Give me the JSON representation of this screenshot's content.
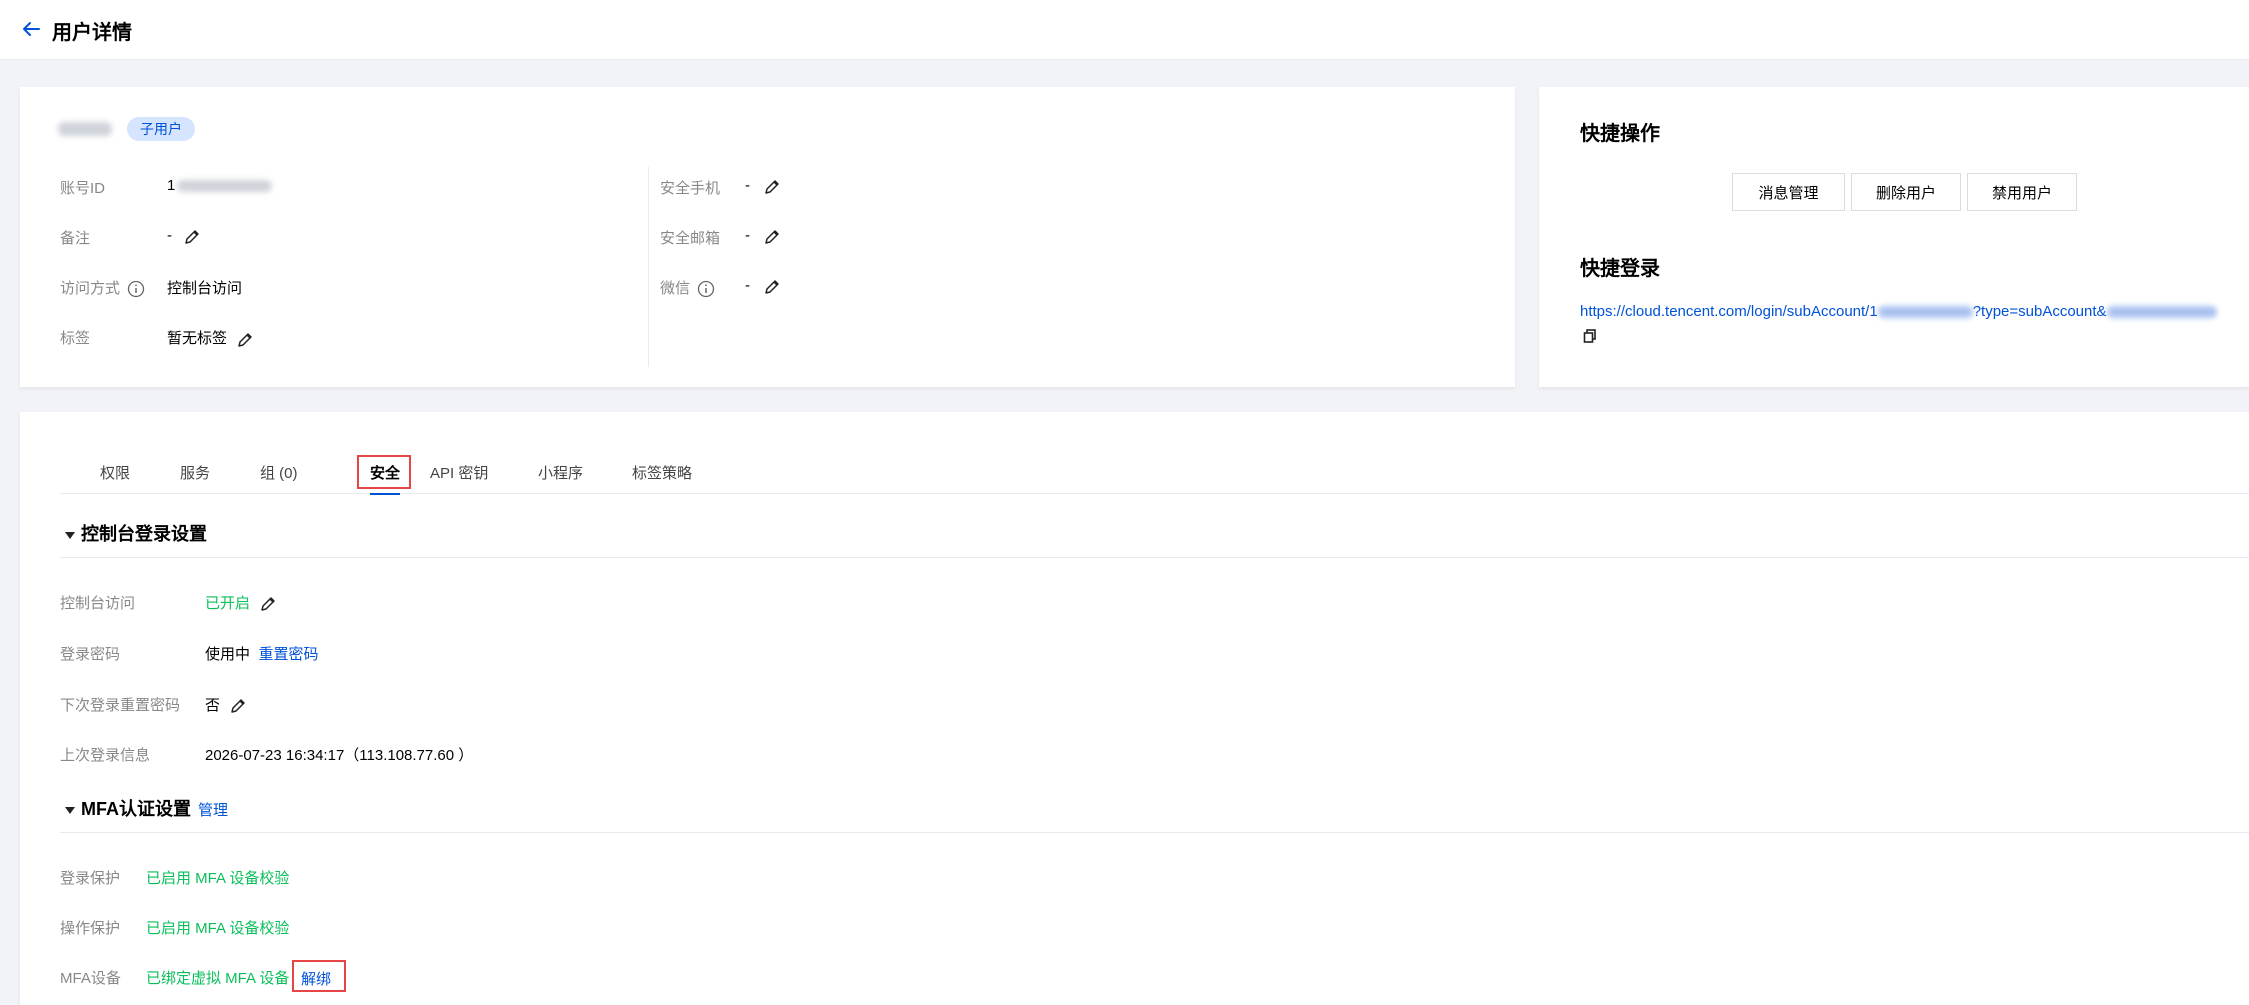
{
  "header": {
    "title": "用户详情",
    "back_icon": "arrow-left-icon"
  },
  "user": {
    "name": "MFA1",
    "badge": "子用户",
    "left_fields": {
      "account_id_label": "账号ID",
      "account_id_value": "1",
      "remark_label": "备注",
      "remark_value": "-",
      "access_label": "访问方式",
      "access_value": "控制台访问",
      "tag_label": "标签",
      "tag_value": "暂无标签"
    },
    "right_fields": {
      "phone_label": "安全手机",
      "phone_value": "-",
      "email_label": "安全邮箱",
      "email_value": "-",
      "wechat_label": "微信",
      "wechat_value": "-"
    }
  },
  "quick_actions": {
    "title": "快捷操作",
    "buttons": [
      "消息管理",
      "删除用户",
      "禁用用户"
    ],
    "login_title": "快捷登录",
    "login_url_prefix": "https://cloud.tencent.com/login/subAccount/1",
    "login_url_middle": "?type=subAccount&",
    "copy_icon": "copy-icon"
  },
  "tabs": [
    "权限",
    "服务",
    "组 (0)",
    "安全",
    "API 密钥",
    "小程序",
    "标签策略"
  ],
  "active_tab": "安全",
  "console_section": {
    "title": "控制台登录设置",
    "rows": {
      "console_access_label": "控制台访问",
      "console_access_value": "已开启",
      "password_label": "登录密码",
      "password_value": "使用中",
      "password_link": "重置密码",
      "reset_next_label": "下次登录重置密码",
      "reset_next_value": "否",
      "last_login_label": "上次登录信息",
      "last_login_value": "2026-07-23 16:34:17（113.108.77.60 ）"
    }
  },
  "mfa_section": {
    "title": "MFA认证设置",
    "manage_link": "管理",
    "rows": {
      "login_protect_label": "登录保护",
      "login_protect_value": "已启用 MFA 设备校验",
      "op_protect_label": "操作保护",
      "op_protect_value": "已启用 MFA 设备校验",
      "device_label": "MFA设备",
      "device_value": "已绑定虚拟 MFA 设备",
      "unbind_link": "解绑"
    }
  },
  "colors": {
    "primary": "#0052d9",
    "success": "#0abf5b",
    "highlight": "#e54545",
    "page_bg": "#f2f3f8"
  }
}
